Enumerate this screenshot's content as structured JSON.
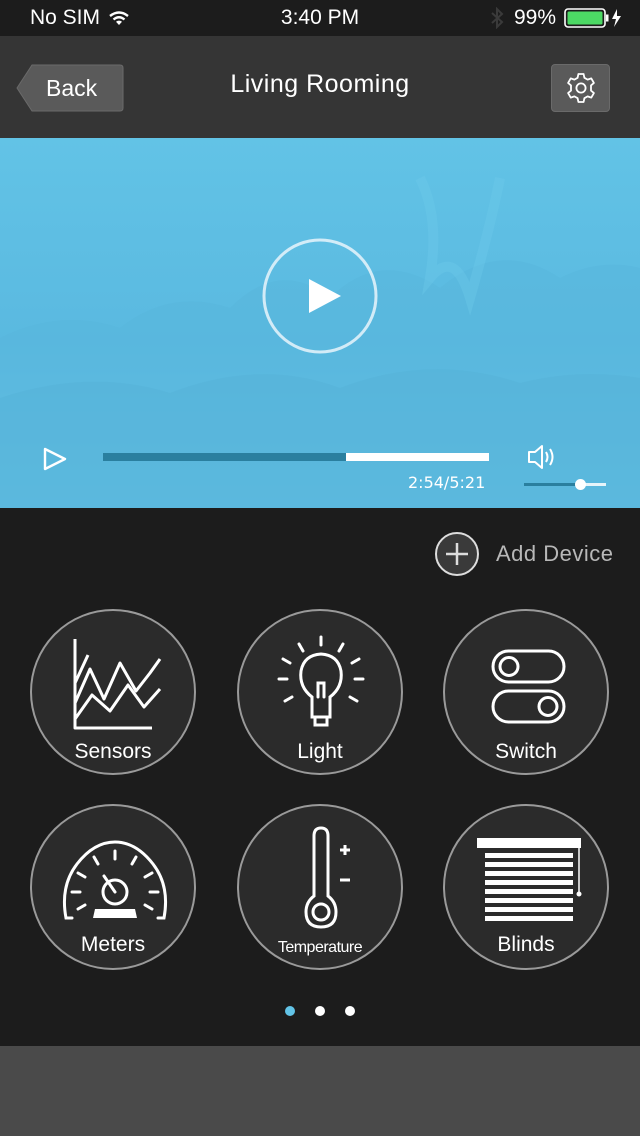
{
  "status_bar": {
    "carrier": "No SIM",
    "time": "3:40 PM",
    "battery": "99%"
  },
  "nav": {
    "back_label": "Back",
    "title": "Living Rooming"
  },
  "video": {
    "time_label": "2:54/5:21",
    "progress": 0.63,
    "volume": 0.68
  },
  "devices": {
    "add_label": "Add Device",
    "tiles": [
      "Sensors",
      "Light",
      "Switch",
      "Meters",
      "Temperature",
      "Blinds"
    ]
  },
  "pager": {
    "pages": 3,
    "current": 1
  },
  "colors": {
    "accent": "#62c3e6",
    "progress_fill": "#2a7f9f",
    "battery": "#4cd964"
  }
}
